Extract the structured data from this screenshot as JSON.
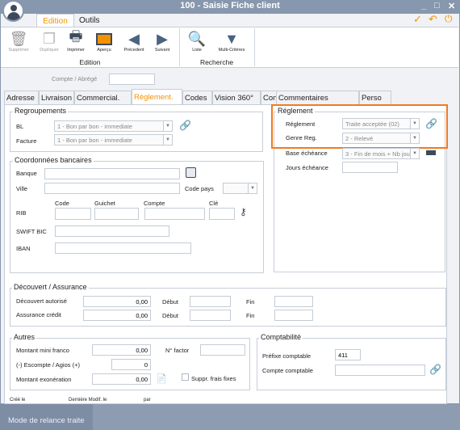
{
  "window": {
    "title": "100 - Saisie Fiche client",
    "controls": [
      "_",
      "□",
      "✕"
    ]
  },
  "ribbon": {
    "tabs": [
      "Edition",
      "Outils"
    ],
    "active_tab": "Edition",
    "buttons": [
      {
        "label": "Supprimer",
        "icon": "trash-icon",
        "enabled": false
      },
      {
        "label": "Dupliquer",
        "icon": "duplicate-icon",
        "enabled": false
      },
      {
        "label": "Imprimer",
        "icon": "printer-icon",
        "enabled": true
      },
      {
        "label": "Aperçu",
        "icon": "monitor-icon",
        "enabled": true
      },
      {
        "label": "Précedent",
        "icon": "arrow-left-icon",
        "enabled": true
      },
      {
        "label": "Suivant",
        "icon": "arrow-right-icon",
        "enabled": true
      },
      {
        "label": "Liste",
        "icon": "search-icon",
        "enabled": true
      },
      {
        "label": "Multi-Critères",
        "icon": "filter-icon",
        "enabled": true
      }
    ],
    "groups": [
      "Edition",
      "Recherche"
    ],
    "actions": [
      "validate-icon",
      "undo-icon",
      "power-icon"
    ]
  },
  "header": {
    "compte_label": "Compte / Abrégé",
    "compte_value": ""
  },
  "tabs": [
    "Adresse",
    "Livraison",
    "Commercial.",
    "Règlement.",
    "Codes",
    "Vision 360°",
    "Contacts",
    "Commentaires",
    "Perso"
  ],
  "active_tab": "Règlement.",
  "regroupements": {
    "title": "Regroupements",
    "bl_label": "BL",
    "bl_value": "1 - Bon par bon - immediate",
    "facture_label": "Facture",
    "facture_value": "1 - Bon par bon - immediate"
  },
  "banque": {
    "title": "Coordonnées bancaires",
    "banque_label": "Banque",
    "ville_label": "Ville",
    "code_pays_label": "Code pays",
    "rib_label": "RIB",
    "code_label": "Code",
    "guichet_label": "Guichet",
    "compte_label": "Compte",
    "cle_label": "Clé",
    "swift_label": "SWIFT BIC",
    "iban_label": "IBAN"
  },
  "reglement": {
    "title": "Réglement",
    "reglement_label": "Réglement",
    "reglement_value": "Traite acceptée (02)",
    "genre_label": "Genre Reg.",
    "genre_value": "2 - Relevé",
    "base_label": "Base échéance",
    "base_value": "3 - Fin de mois + Nb jour",
    "jours_label": "Jours échéance",
    "jours_value": "",
    "highlight_color": "#f07b22"
  },
  "decouvert": {
    "title": "Découvert / Assurance",
    "decouvert_label": "Découvert autorisé",
    "decouvert_value": "0,00",
    "assurance_label": "Assurance crédit",
    "assurance_value": "0,00",
    "debut_label": "Début",
    "fin_label": "Fin"
  },
  "autres": {
    "title": "Autres",
    "mini_label": "Montant mini franco",
    "mini_value": "0,00",
    "factor_label": "N° factor",
    "escompte_label": "(-) Escompte / Agios (+)",
    "escompte_value": "0",
    "exo_label": "Montant exonération",
    "exo_value": "0,00",
    "frais_label": "Suppr. frais fixes",
    "frais_checked": false
  },
  "compta": {
    "title": "Comptabilité",
    "prefixe_label": "Préfixe comptable",
    "prefixe_value": "411",
    "compte_label": "Compte comptable",
    "compte_value": ""
  },
  "footer": {
    "cree": "Créé le",
    "modif": "Dernière Modif. le",
    "par": "par"
  },
  "background": {
    "item": "Mode de relance traite"
  }
}
